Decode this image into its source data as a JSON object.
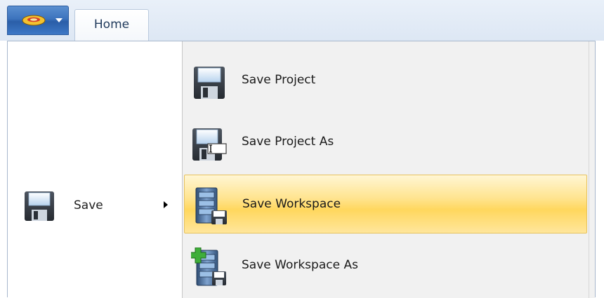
{
  "ribbon": {
    "app_button": {
      "icon": "app-logo-icon"
    },
    "tabs": [
      {
        "label": "Home"
      }
    ]
  },
  "menu": {
    "left_items": [
      {
        "label": "Save",
        "icon": "floppy-disk-icon",
        "has_submenu": true
      }
    ],
    "submenu": [
      {
        "label": "Save Project",
        "icon": "floppy-disk-icon"
      },
      {
        "label": "Save Project As",
        "icon": "floppy-disk-rename-icon"
      },
      {
        "label": "Save Workspace",
        "icon": "server-save-icon",
        "highlighted": true
      },
      {
        "label": "Save Workspace As",
        "icon": "server-save-add-icon"
      }
    ]
  },
  "colors": {
    "highlight": "#ffd75e",
    "app_button": "#3c73bd",
    "tab_text": "#1e395b"
  }
}
